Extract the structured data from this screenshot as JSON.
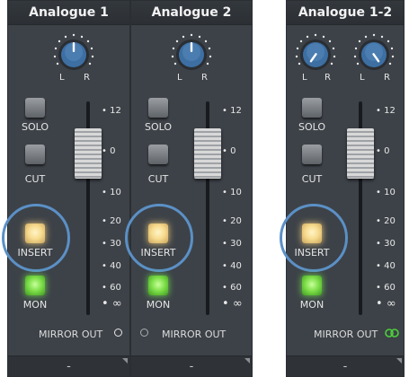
{
  "strips": [
    {
      "title": "Analogue 1",
      "pan": {
        "left": "L",
        "right": "R"
      },
      "solo_label": "SOLO",
      "cut_label": "CUT",
      "insert_label": "INSERT",
      "mon_label": "MON",
      "scale": [
        "12",
        "0",
        "10",
        "20",
        "30",
        "40",
        "60",
        "∞"
      ],
      "mirror_label": "MIRROR OUT",
      "bottom_label": "-"
    },
    {
      "title": "Analogue 2",
      "pan": {
        "left": "L",
        "right": "R"
      },
      "solo_label": "SOLO",
      "cut_label": "CUT",
      "insert_label": "INSERT",
      "mon_label": "MON",
      "scale": [
        "12",
        "0",
        "10",
        "20",
        "30",
        "40",
        "60",
        "∞"
      ],
      "mirror_label": "MIRROR OUT",
      "bottom_label": "-"
    },
    {
      "title": "Analogue 1-2",
      "pan": {
        "left": "L",
        "right": "R"
      },
      "solo_label": "SOLO",
      "cut_label": "CUT",
      "insert_label": "INSERT",
      "mon_label": "MON",
      "scale": [
        "12",
        "0",
        "10",
        "20",
        "30",
        "40",
        "60",
        "∞"
      ],
      "mirror_label": "MIRROR OUT",
      "bottom_label": "-"
    }
  ],
  "icons": {
    "knob": "pan-knob-icon",
    "mirror_off": "circle-outline-icon",
    "mirror_linked": "link-rings-icon"
  },
  "colors": {
    "strip_bg": "#3d4248",
    "knob_blue": "#3d6fa3",
    "insert_active": "#f7dc8f",
    "mon_active": "#7fe04a",
    "highlight_ring": "#5b90c6",
    "link_green": "#4cd23a"
  }
}
